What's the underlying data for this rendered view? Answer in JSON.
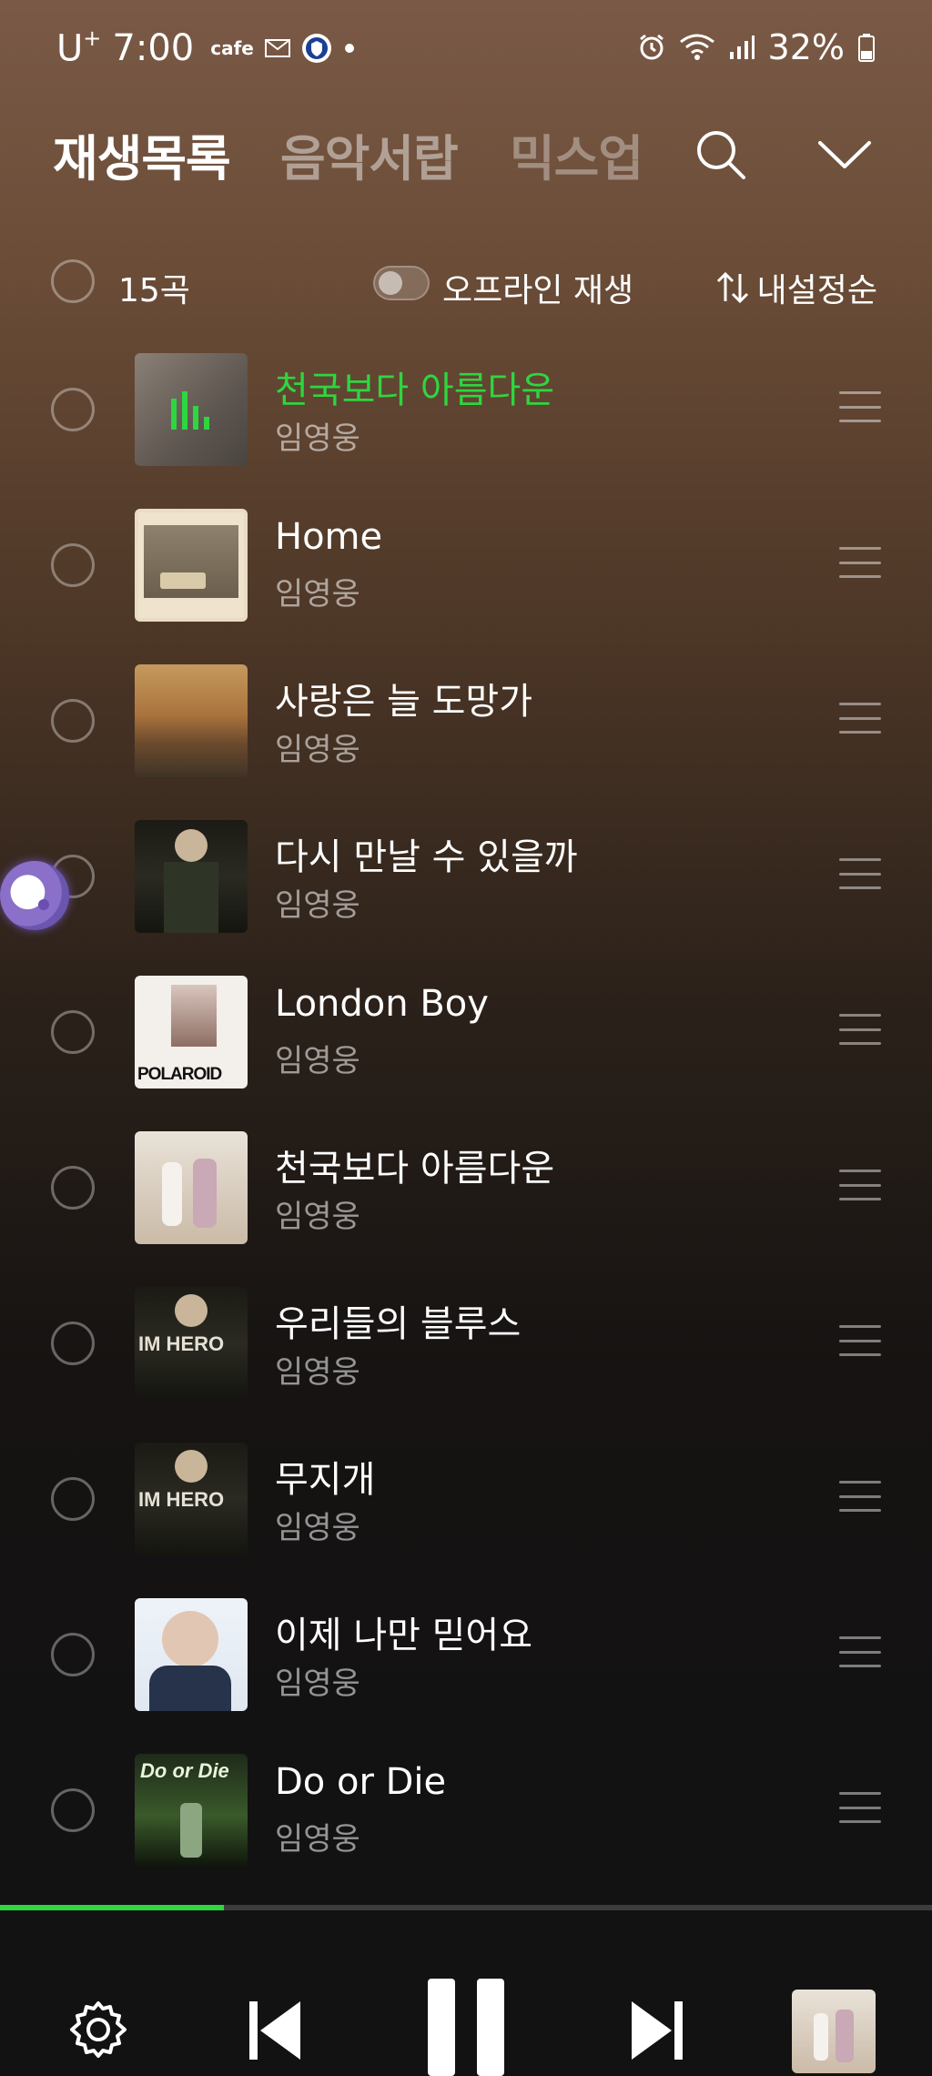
{
  "status_bar": {
    "carrier": "U",
    "carrier_sup": "+",
    "time": "7:00",
    "cafe_label": "cafe",
    "battery": "32%"
  },
  "header": {
    "tabs": [
      {
        "label": "재생목록",
        "active": true
      },
      {
        "label": "음악서랍",
        "active": false
      },
      {
        "label": "믹스업",
        "active": false
      }
    ]
  },
  "toolbar": {
    "count": "15곡",
    "offline_label": "오프라인 재생",
    "sort_label": "내설정순"
  },
  "songs": [
    {
      "title": "천국보다 아름다운",
      "artist": "임영웅",
      "playing": true
    },
    {
      "title": "Home",
      "artist": "임영웅"
    },
    {
      "title": "사랑은 늘 도망가",
      "artist": "임영웅"
    },
    {
      "title": "다시 만날 수 있을까",
      "artist": "임영웅"
    },
    {
      "title": "London Boy",
      "artist": "임영웅",
      "art_text": "POLAROID"
    },
    {
      "title": "천국보다 아름다운",
      "artist": "임영웅"
    },
    {
      "title": "우리들의 블루스",
      "artist": "임영웅",
      "art_text": "IM HERO"
    },
    {
      "title": "무지개",
      "artist": "임영웅",
      "art_text": "IM HERO"
    },
    {
      "title": "이제 나만 믿어요",
      "artist": "임영웅"
    },
    {
      "title": "Do or Die",
      "artist": "임영웅",
      "art_text": "Do or Die"
    }
  ],
  "player": {
    "progress_fraction": 0.24
  },
  "colors": {
    "accent_green": "#2ed63f"
  }
}
